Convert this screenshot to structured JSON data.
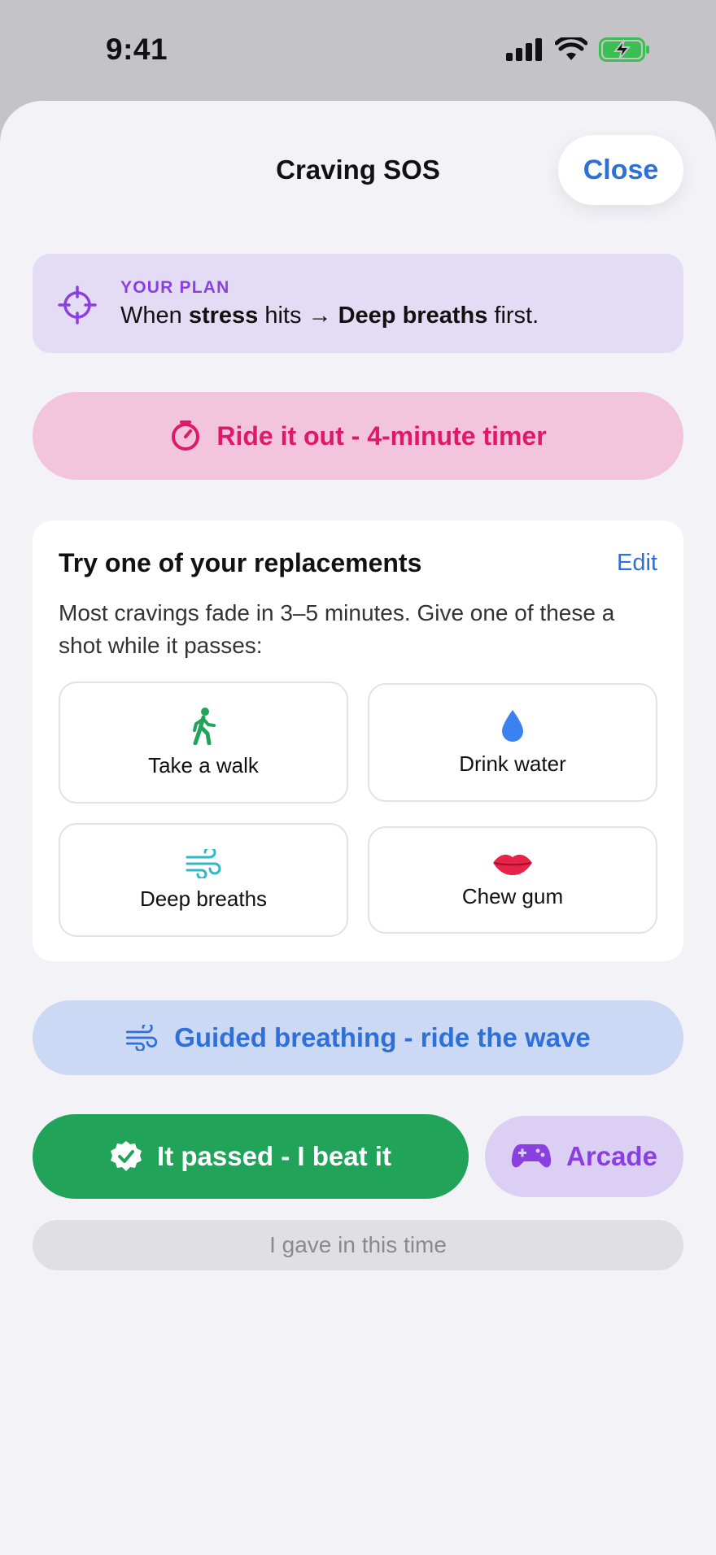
{
  "status_bar": {
    "time": "9:41"
  },
  "header": {
    "title": "Craving SOS",
    "close_label": "Close"
  },
  "plan": {
    "label": "YOUR PLAN",
    "prefix": "When ",
    "trigger": "stress",
    "middle": " hits → ",
    "action": "Deep breaths",
    "suffix": " first."
  },
  "timer_button": {
    "label": "Ride it out - 4-minute timer"
  },
  "replacements": {
    "title": "Try one of your replacements",
    "edit_label": "Edit",
    "description": "Most cravings fade in 3–5 minutes. Give one of these a shot while it passes:",
    "items": [
      {
        "label": "Take a walk",
        "icon": "walking-person-icon"
      },
      {
        "label": "Drink water",
        "icon": "water-drop-icon"
      },
      {
        "label": "Deep breaths",
        "icon": "wind-icon"
      },
      {
        "label": "Chew gum",
        "icon": "lips-icon"
      }
    ]
  },
  "breathing_button": {
    "label": "Guided breathing - ride the wave"
  },
  "passed_button": {
    "label": "It passed - I beat it"
  },
  "arcade_button": {
    "label": "Arcade"
  },
  "gave_in_button": {
    "label": "I gave in this time"
  },
  "colors": {
    "accent_blue": "#2f6fd8",
    "accent_purple": "#8a3fe0",
    "accent_pink": "#e0186a",
    "accent_green": "#22a35a"
  }
}
